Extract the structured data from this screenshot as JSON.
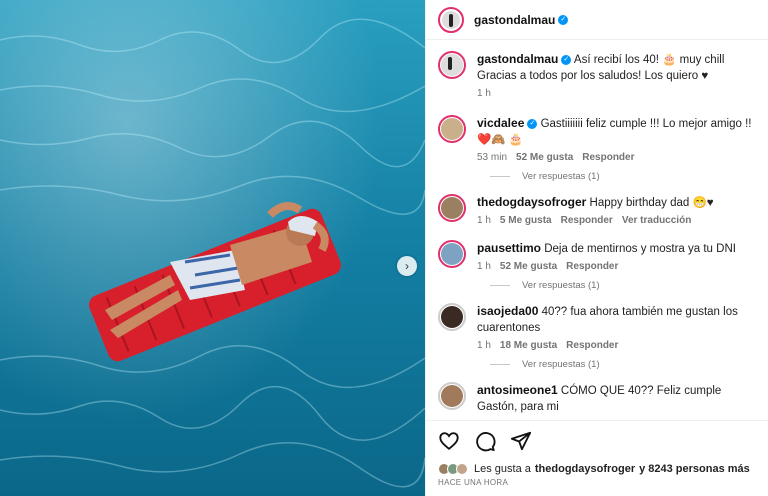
{
  "post": {
    "author": "gastondalmau",
    "caption_line1": "Así recibí los 40! 🎂 muy chill",
    "caption_line2": "Gracias a todos por los saludos! Los quiero ♥",
    "caption_time": "1 h"
  },
  "comments": [
    {
      "user": "vicdalee",
      "verified": true,
      "text": "Gastiiiiiii feliz cumple !!! Lo mejor amigo !! ❤️🙈 🎂",
      "time": "53 min",
      "likes": "52 Me gusta",
      "reply": "Responder",
      "translate": "",
      "replies": "Ver respuestas (1)"
    },
    {
      "user": "thedogdaysofroger",
      "verified": false,
      "text": "Happy birthday dad 😁♥",
      "time": "1 h",
      "likes": "5 Me gusta",
      "reply": "Responder",
      "translate": "Ver traducción",
      "replies": ""
    },
    {
      "user": "pausettimo",
      "verified": false,
      "text": "Deja de mentirnos y mostra ya tu DNI",
      "time": "1 h",
      "likes": "52 Me gusta",
      "reply": "Responder",
      "translate": "",
      "replies": "Ver respuestas (1)"
    },
    {
      "user": "isaojeda00",
      "verified": false,
      "text": "40?? fua ahora también me gustan los cuarentones",
      "time": "1 h",
      "likes": "18 Me gusta",
      "reply": "Responder",
      "translate": "",
      "replies": "Ver respuestas (1)"
    },
    {
      "user": "antosimeone1",
      "verified": false,
      "text": "CÓMO QUE 40?? Feliz cumple Gastón, para mi",
      "time": "",
      "likes": "",
      "reply": "",
      "translate": "",
      "replies": ""
    }
  ],
  "actions": {
    "likes_prefix": "Les gusta a",
    "likes_user": "thedogdaysofroger",
    "likes_suffix": "y 8243 personas más",
    "time_ago": "HACE UNA HORA"
  },
  "icons": [
    "heart-icon",
    "comment-icon",
    "share-icon",
    "chevron-right-icon",
    "verified-icon"
  ],
  "colors": {
    "verified": "#0095f6",
    "story_ring": "#e1306c",
    "water": "#1b8fb0",
    "float": "#d8202c"
  }
}
